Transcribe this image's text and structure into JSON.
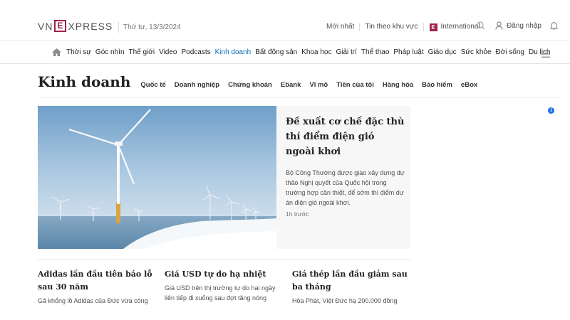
{
  "header": {
    "logo_left": "VN",
    "logo_e": "E",
    "logo_right": "XPRESS",
    "date": "Thứ tư, 13/3/2024",
    "links": [
      "Mới nhất",
      "Tin theo khu vực"
    ],
    "international_icon": "E",
    "international": "International",
    "login": "Đăng nhập",
    "icons": [
      "search-icon",
      "user-icon",
      "bell-icon"
    ]
  },
  "nav": {
    "home_icon": "home-icon",
    "items": [
      "Thời sự",
      "Góc nhìn",
      "Thế giới",
      "Video",
      "Podcasts",
      "Kinh doanh",
      "Bất động sản",
      "Khoa học",
      "Giải trí",
      "Thể thao",
      "Pháp luật",
      "Giáo dục",
      "Sức khỏe",
      "Đời sống",
      "Du lịch"
    ],
    "active": "Kinh doanh",
    "menu_icon": "hamburger-menu-icon"
  },
  "section": {
    "title": "Kinh doanh",
    "subnav": [
      "Quốc tế",
      "Doanh nghiệp",
      "Chứng khoán",
      "Ebank",
      "Vĩ mô",
      "Tiền của tôi",
      "Hàng hóa",
      "Bảo hiểm",
      "eBox"
    ]
  },
  "feature": {
    "image": "offshore-wind-turbines-image",
    "title": "Đề xuất cơ chế đặc thù thí điểm điện gió ngoài khơi",
    "description": "Bộ Công Thương được giao xây dựng dự thảo Nghị quyết của Quốc hội trong trường hợp cần thiết, để sớm thí điểm dự án điện gió ngoài khơi.",
    "time": "1h trước"
  },
  "ad_icon": "i",
  "news": [
    {
      "title": "Adidas lần đầu tiên báo lỗ sau 30 năm",
      "description": "Gã khổng lồ Adidas của Đức vừa công"
    },
    {
      "title": "Giá USD tự do hạ nhiệt",
      "description": "Giá USD trên thị trường tự do hai ngày liên tiếp đi xuống sau đợt tăng nóng"
    },
    {
      "title": "Giá thép lần đầu giảm sau ba tháng",
      "description": "Hòa Phát, Việt Đức hạ 200.000 đồng"
    }
  ],
  "colors": {
    "brand": "#9f224e",
    "active_link": "#076db6",
    "ad_icon": "#1a73e8"
  }
}
